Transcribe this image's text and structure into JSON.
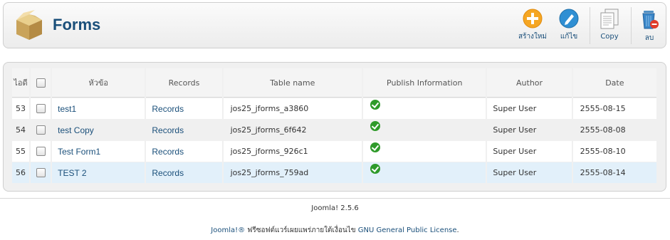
{
  "header": {
    "title": "Forms",
    "buttons": [
      {
        "label": "สร้างใหม่",
        "icon": "new-icon"
      },
      {
        "label": "แก้ไข",
        "icon": "edit-icon"
      },
      {
        "label": "Copy",
        "icon": "copy-icon"
      },
      {
        "label": "ลบ",
        "icon": "delete-icon"
      }
    ]
  },
  "table": {
    "columns": {
      "id": "ไอดี",
      "title": "หัวข้อ",
      "records": "Records",
      "table_name": "Table name",
      "publish": "Publish Information",
      "author": "Author",
      "date": "Date"
    },
    "rows": [
      {
        "id": "53",
        "title": "test1",
        "records": "Records",
        "table_name": "jos25_jforms_a3860",
        "author": "Super User",
        "date": "2555-08-15"
      },
      {
        "id": "54",
        "title": "test Copy",
        "records": "Records",
        "table_name": "jos25_jforms_6f642",
        "author": "Super User",
        "date": "2555-08-08"
      },
      {
        "id": "55",
        "title": "Test Form1",
        "records": "Records",
        "table_name": "jos25_jforms_926c1",
        "author": "Super User",
        "date": "2555-08-10"
      },
      {
        "id": "56",
        "title": "TEST 2",
        "records": "Records",
        "table_name": "jos25_jforms_759ad",
        "author": "Super User",
        "date": "2555-08-14"
      }
    ]
  },
  "footer": {
    "version": "Joomla! 2.5.6",
    "license_link1": "Joomla!®",
    "license_text": " ฟรีซอฟต์แวร์เผยแพร่ภายใต้เงื่อนไข ",
    "license_link2": "GNU General Public License",
    "license_end": "."
  },
  "colors": {
    "link": "#1a4f7a",
    "highlight_row": "#e2f0fa",
    "published": "#2f9a2a"
  }
}
